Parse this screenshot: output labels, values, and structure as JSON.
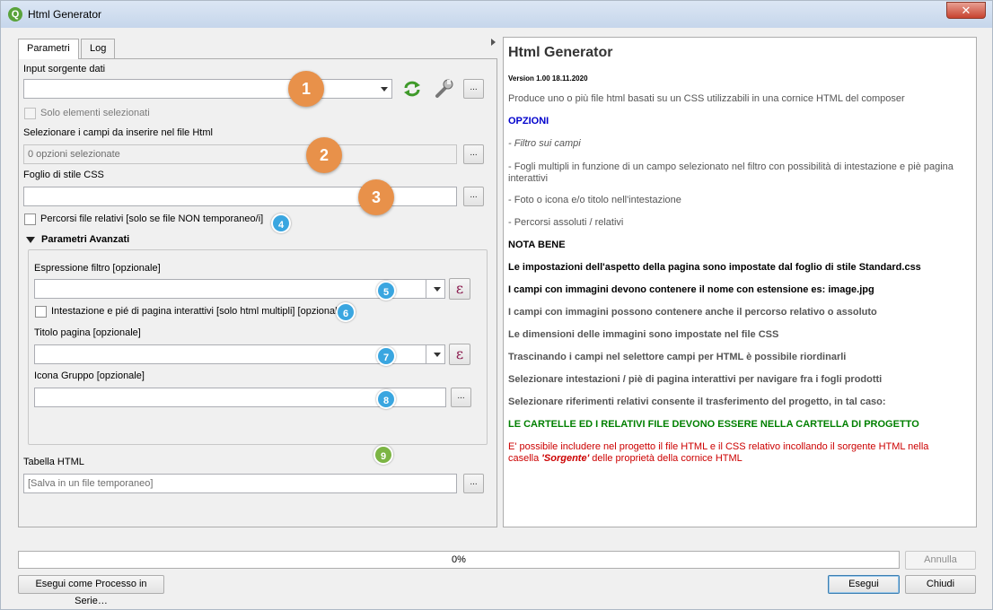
{
  "window": {
    "title": "Html Generator",
    "close_label": "✕"
  },
  "tabs": [
    {
      "label": "Parametri",
      "active": true
    },
    {
      "label": "Log",
      "active": false
    }
  ],
  "params": {
    "input_label": "Input sorgente dati",
    "input_value": "",
    "only_selected_label": "Solo elementi selezionati",
    "fields_label": "Selezionare i campi da inserire nel file Html",
    "fields_value": "0 opzioni selezionate",
    "css_label": "Foglio di stile CSS",
    "css_value": "",
    "relative_paths_label": "Percorsi file relativi [solo se  file NON temporaneo/i]",
    "advanced_label": "Parametri Avanzati",
    "filter_label": "Espressione filtro [opzionale]",
    "filter_value": "",
    "interactive_label": "Intestazione e pié di pagina interattivi [solo html multipli] [opzionale]",
    "page_title_label": "Titolo pagina [opzionale]",
    "page_title_value": "",
    "group_icon_label": "Icona Gruppo [opzionale]",
    "group_icon_value": "",
    "html_table_label": "Tabella HTML",
    "html_table_placeholder": "[Salva in un file temporaneo]",
    "browse_label": "...",
    "epsilon_label": "ε"
  },
  "badges": {
    "b1": "1",
    "b2": "2",
    "b3": "3",
    "b4": "4",
    "b5": "5",
    "b6": "6",
    "b7": "7",
    "b8": "8",
    "b9": "9"
  },
  "colors": {
    "badge_orange": "#e8914a",
    "badge_blue": "#3aa6e0",
    "badge_green": "#7cb544",
    "help_blue": "#0000cc",
    "help_green": "#008000",
    "help_red": "#cc0000"
  },
  "help": {
    "title": "Html Generator",
    "version": "Version 1.00 18.11.2020",
    "intro": "Produce uno o più file html basati su un CSS utilizzabili in una cornice HTML del composer",
    "options_heading": "OPZIONI",
    "opt1": "- Filtro sui campi",
    "opt2": "- Fogli multipli in funzione di un campo selezionato nel filtro con possibilità di intestazione e piè pagina interattivi",
    "opt3": "- Foto o icona e/o titolo nell'intestazione",
    "opt4": "- Percorsi assoluti / relativi",
    "note_heading": "NOTA BENE",
    "note1": "Le impostazioni dell'aspetto della pagina sono impostate dal foglio di stile Standard.css",
    "note2": "I campi con immagini devono contenere il nome con estensione es: image.jpg",
    "note3": "I campi con immagini possono contenere anche il percorso relativo o assoluto",
    "note4": "Le dimensioni delle immagini sono impostate nel file CSS",
    "note5": "Trascinando i campi nel selettore campi per HTML è possibile riordinarli",
    "note6": "Selezionare intestazioni / piè di pagina interattivi per navigare fra i fogli prodotti",
    "note7": "Selezionare riferimenti relativi consente il trasferimento del progetto, in tal caso:",
    "green_line": "LE CARTELLE ED I RELATIVI FILE DEVONO ESSERE NELLA CARTELLA DI PROGETTO",
    "red_line1": "E' possibile includere nel progetto il file HTML e il CSS relativo incollando il sorgente HTML nella",
    "red_line2_pre": "casella ",
    "red_line2_em": "'Sorgente'",
    "red_line2_post": " delle proprietà della cornice HTML"
  },
  "footer": {
    "progress_text": "0%",
    "progress_value": 0,
    "cancel_label": "Annulla",
    "batch_label": "Esegui come Processo in Serie…",
    "run_label": "Esegui",
    "close_label": "Chiudi"
  }
}
